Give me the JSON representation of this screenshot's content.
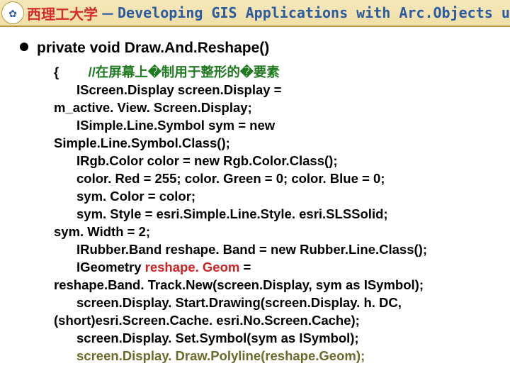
{
  "header": {
    "university": "西理工大学",
    "separator": "－",
    "subtitle": "Developing GIS Applications with Arc.Objects using C#. NE",
    "logo_glyph": "✿"
  },
  "bullet": {
    "signature": "private void Draw.And.Reshape()"
  },
  "code": {
    "l1_open": "{",
    "l1_comment": "//在屏幕上�制用于整形的�要素",
    "l2a": "IScreen.Display screen.Display =",
    "l2b": "m_active. View. Screen.Display;",
    "l3a": "ISimple.Line.Symbol sym = new",
    "l3b": "Simple.Line.Symbol.Class();",
    "l4": "IRgb.Color color = new Rgb.Color.Class();",
    "l5": "color. Red = 255;   color. Green = 0;    color. Blue = 0;",
    "l6": "sym. Color = color;",
    "l7a": "sym. Style = esri.Simple.Line.Style. esri.SLSSolid;",
    "l7b": "sym. Width = 2;",
    "l8": "IRubber.Band reshape. Band = new Rubber.Line.Class();",
    "l9a_pre": "IGeometry ",
    "l9a_hl": "reshape. Geom",
    "l9a_post": " =",
    "l9b": "reshape.Band. Track.New(screen.Display, sym as ISymbol);",
    "l10a": "screen.Display. Start.Drawing(screen.Display. h. DC,",
    "l10b": "(short)esri.Screen.Cache. esri.No.Screen.Cache);",
    "l11": "screen.Display. Set.Symbol(sym as ISymbol);",
    "l12": "screen.Display. Draw.Polyline(reshape.Geom);"
  }
}
